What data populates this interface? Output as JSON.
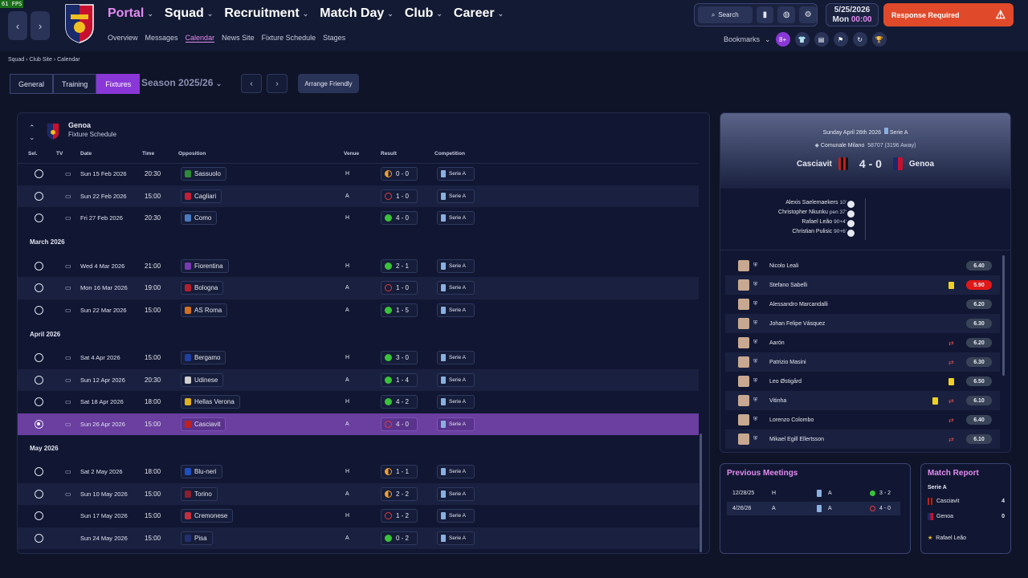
{
  "fps": "61 FPS",
  "nav": {
    "menu": [
      {
        "label": "Portal",
        "active": true
      },
      {
        "label": "Squad",
        "active": false
      },
      {
        "label": "Recruitment",
        "active": false
      },
      {
        "label": "Match Day",
        "active": false
      },
      {
        "label": "Club",
        "active": false
      },
      {
        "label": "Career",
        "active": false
      }
    ],
    "submenu": [
      "Overview",
      "Messages",
      "Calendar",
      "News Site",
      "Fixture Schedule",
      "Stages"
    ],
    "submenu_active": "Calendar",
    "search_label": "Search",
    "date": "5/25/2026",
    "day": "Mon",
    "time": "00:00",
    "response_label": "Response Required",
    "bookmarks_label": "Bookmarks",
    "bookmark_badge": "8+"
  },
  "breadcrumb": [
    "Squad",
    "Club Site",
    "Calendar"
  ],
  "tabs": [
    {
      "label": "General",
      "active": false
    },
    {
      "label": "Training",
      "active": false
    },
    {
      "label": "Fixtures",
      "active": true
    }
  ],
  "season_label": "Season 2025/26",
  "arrange_friendly_label": "Arrange Friendly",
  "fixtures": {
    "club": "Genoa",
    "subtitle": "Fixture Schedule",
    "columns": {
      "sel": "Sel.",
      "tv": "TV",
      "date": "Date",
      "time": "Time",
      "opposition": "Opposition",
      "venue": "Venue",
      "result": "Result",
      "competition": "Competition"
    },
    "groups": [
      {
        "month": "",
        "rows": [
          {
            "date": "Sun 15 Feb 2026",
            "time": "20:30",
            "opp": "Sassuolo",
            "oppColor": "#2e8b3a",
            "venue": "H",
            "result": "0 - 0",
            "outcome": "d",
            "comp": "Serie A",
            "tv": true
          },
          {
            "date": "Sun 22 Feb 2026",
            "time": "15:00",
            "opp": "Cagliari",
            "oppColor": "#c0203a",
            "venue": "A",
            "result": "1 - 0",
            "outcome": "l",
            "comp": "Serie A",
            "tv": true
          },
          {
            "date": "Fri 27 Feb 2026",
            "time": "20:30",
            "opp": "Como",
            "oppColor": "#4a7ac0",
            "venue": "H",
            "result": "4 - 0",
            "outcome": "w",
            "comp": "Serie A",
            "tv": true
          }
        ]
      },
      {
        "month": "March 2026",
        "rows": [
          {
            "date": "Wed 4 Mar 2026",
            "time": "21:00",
            "opp": "Fiorentina",
            "oppColor": "#7a3ab0",
            "venue": "H",
            "result": "2 - 1",
            "outcome": "w",
            "comp": "Serie A",
            "tv": true
          },
          {
            "date": "Mon 16 Mar 2026",
            "time": "19:00",
            "opp": "Bologna",
            "oppColor": "#b02030",
            "venue": "A",
            "result": "1 - 0",
            "outcome": "l",
            "comp": "Serie A",
            "tv": true
          },
          {
            "date": "Sun 22 Mar 2026",
            "time": "15:00",
            "opp": "AS Roma",
            "oppColor": "#d07020",
            "venue": "A",
            "result": "1 - 5",
            "outcome": "w",
            "comp": "Serie A",
            "tv": true
          }
        ]
      },
      {
        "month": "April 2026",
        "rows": [
          {
            "date": "Sat 4 Apr 2026",
            "time": "15:00",
            "opp": "Bergamo",
            "oppColor": "#2040a0",
            "venue": "H",
            "result": "3 - 0",
            "outcome": "w",
            "comp": "Serie A",
            "tv": true
          },
          {
            "date": "Sun 12 Apr 2026",
            "time": "20:30",
            "opp": "Udinese",
            "oppColor": "#d0d0d0",
            "venue": "A",
            "result": "1 - 4",
            "outcome": "w",
            "comp": "Serie A",
            "tv": true
          },
          {
            "date": "Sat 18 Apr 2026",
            "time": "18:00",
            "opp": "Hellas Verona",
            "oppColor": "#e0b020",
            "venue": "H",
            "result": "4 - 2",
            "outcome": "w",
            "comp": "Serie A",
            "tv": true
          },
          {
            "date": "Sun 26 Apr 2026",
            "time": "15:00",
            "opp": "Casciavit",
            "oppColor": "#c02020",
            "venue": "A",
            "result": "4 - 0",
            "outcome": "l",
            "comp": "Serie A",
            "tv": true,
            "selected": true
          }
        ]
      },
      {
        "month": "May 2026",
        "rows": [
          {
            "date": "Sat 2 May 2026",
            "time": "18:00",
            "opp": "Blu-neri",
            "oppColor": "#2050c0",
            "venue": "H",
            "result": "1 - 1",
            "outcome": "d",
            "comp": "Serie A",
            "tv": true
          },
          {
            "date": "Sun 10 May 2026",
            "time": "15:00",
            "opp": "Torino",
            "oppColor": "#8a2030",
            "venue": "A",
            "result": "2 - 2",
            "outcome": "d",
            "comp": "Serie A",
            "tv": true
          },
          {
            "date": "Sun 17 May 2026",
            "time": "15:00",
            "opp": "Cremonese",
            "oppColor": "#c03040",
            "venue": "H",
            "result": "1 - 2",
            "outcome": "l",
            "comp": "Serie A",
            "tv": false
          },
          {
            "date": "Sun 24 May 2026",
            "time": "15:00",
            "opp": "Pisa",
            "oppColor": "#203070",
            "venue": "A",
            "result": "0 - 2",
            "outcome": "w",
            "comp": "Serie A",
            "tv": false
          }
        ]
      }
    ]
  },
  "match": {
    "date_line": "Sunday April 26th 2026",
    "competition": "Serie A",
    "stadium": "Comunale Milano",
    "attendance": "58707",
    "away_fans": "(3196 Away)",
    "home": "Casciavit",
    "away": "Genoa",
    "score": "4 - 0",
    "scorers": [
      {
        "name": "Alexis Saelemaekers",
        "min": "10'"
      },
      {
        "name": "Christopher Nkunku",
        "min": "pen 37'"
      },
      {
        "name": "Rafael Leão",
        "min": "90+4'"
      },
      {
        "name": "Christian Pulisic",
        "min": "90+6'"
      }
    ],
    "players": [
      {
        "name": "Nicolo Leali",
        "rating": "6.40",
        "yc": false,
        "sub": false
      },
      {
        "name": "Stefano Sabelli",
        "rating": "5.90",
        "yc": true,
        "sub": false,
        "bad": true
      },
      {
        "name": "Alessandro Marcandalli",
        "rating": "6.20",
        "yc": false,
        "sub": false
      },
      {
        "name": "Johan Felipe Vásquez",
        "rating": "6.30",
        "yc": false,
        "sub": false
      },
      {
        "name": "Aarón",
        "rating": "6.20",
        "yc": false,
        "sub": true
      },
      {
        "name": "Patrizio Masini",
        "rating": "6.30",
        "yc": false,
        "sub": true
      },
      {
        "name": "Leo Østigård",
        "rating": "6.50",
        "yc": true,
        "sub": false
      },
      {
        "name": "Vitinha",
        "rating": "6.10",
        "yc": true,
        "sub": true
      },
      {
        "name": "Lorenzo Colombo",
        "rating": "6.40",
        "yc": false,
        "sub": true
      },
      {
        "name": "Mikael Egill Ellertsson",
        "rating": "6.10",
        "yc": false,
        "sub": true
      }
    ]
  },
  "previous_meetings": {
    "title": "Previous Meetings",
    "rows": [
      {
        "date": "12/28/25",
        "venue": "H",
        "comp": "A",
        "result": "3 - 2",
        "outcome": "w"
      },
      {
        "date": "4/26/26",
        "venue": "A",
        "comp": "A",
        "result": "4 - 0",
        "outcome": "l"
      }
    ]
  },
  "match_report": {
    "title": "Match Report",
    "competition": "Serie A",
    "home": "Casciavit",
    "home_score": "4",
    "away": "Genoa",
    "away_score": "0",
    "motm": "Rafael Leão"
  },
  "colors": {
    "accent": "#8a37d8",
    "brand_pink": "#e38bf0",
    "alert": "#e04a2a"
  }
}
